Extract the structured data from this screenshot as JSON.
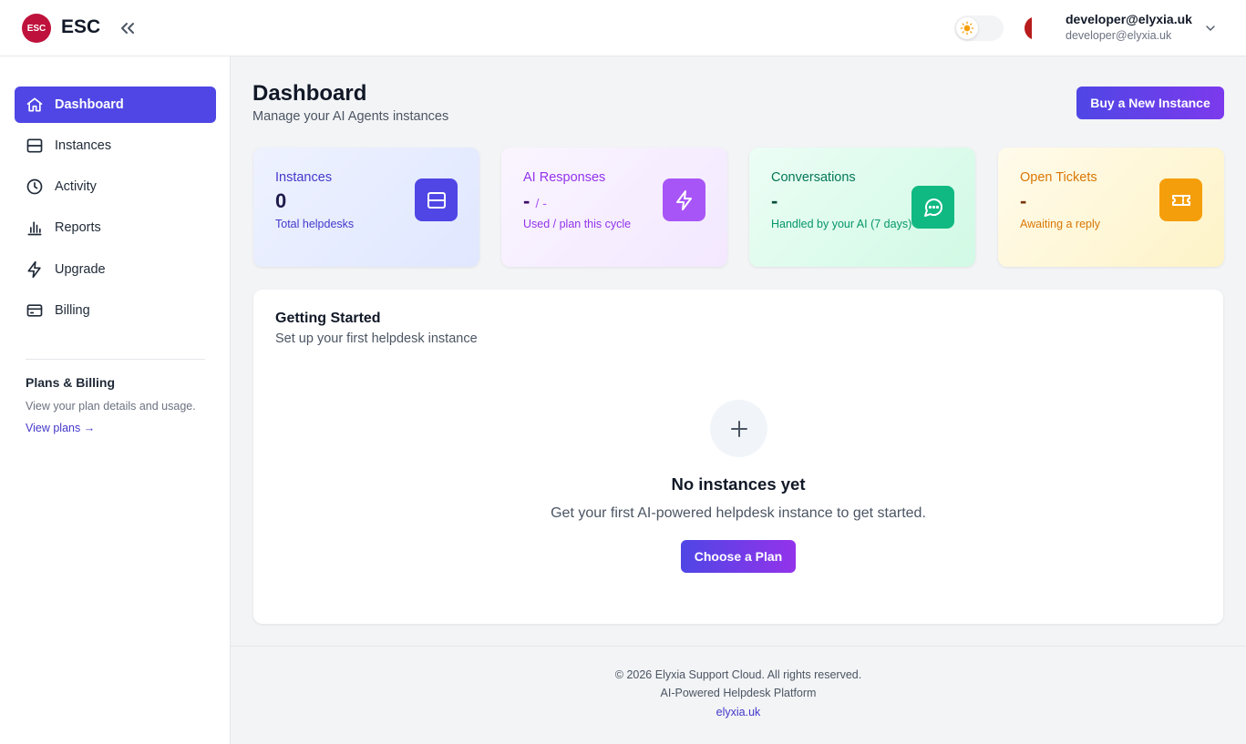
{
  "header": {
    "logo_text": "ESC",
    "brand": "ESC",
    "user_name": "developer@elyxia.uk",
    "user_email": "developer@elyxia.uk",
    "icons": {
      "collapse": "double-chevron-left-icon",
      "theme": "sun-icon",
      "menu": "chevron-down-icon"
    }
  },
  "sidebar": {
    "items": [
      {
        "label": "Dashboard",
        "icon": "home-icon",
        "active": true
      },
      {
        "label": "Instances",
        "icon": "server-icon",
        "active": false
      },
      {
        "label": "Activity",
        "icon": "clock-icon",
        "active": false
      },
      {
        "label": "Reports",
        "icon": "bar-chart-icon",
        "active": false
      },
      {
        "label": "Upgrade",
        "icon": "lightning-icon",
        "active": false
      },
      {
        "label": "Billing",
        "icon": "credit-card-icon",
        "active": false
      }
    ],
    "plans": {
      "title": "Plans & Billing",
      "description": "View your plan details and usage.",
      "link": "View plans →"
    }
  },
  "main": {
    "title": "Dashboard",
    "subtitle": "Manage your AI Agents instances",
    "buy_button": "Buy a New Instance",
    "stats": [
      {
        "label": "Instances",
        "value": "0",
        "sub": "",
        "desc": "Total helpdesks",
        "icon": "server-icon",
        "color": "#4f46e5"
      },
      {
        "label": "AI Responses",
        "value": "-",
        "sub": "/ -",
        "desc": "Used / plan this cycle",
        "icon": "lightning-icon",
        "color": "#a855f7"
      },
      {
        "label": "Conversations",
        "value": "-",
        "sub": "",
        "desc": "Handled by your AI (7 days)",
        "icon": "chat-bubble-icon",
        "color": "#10b981"
      },
      {
        "label": "Open Tickets",
        "value": "-",
        "sub": "",
        "desc": "Awaiting a reply",
        "icon": "ticket-icon",
        "color": "#f59e0b"
      }
    ],
    "getting_started": {
      "title": "Getting Started",
      "subtitle": "Set up your first helpdesk instance",
      "empty_title": "No instances yet",
      "empty_desc": "Get your first AI-powered helpdesk instance to get started.",
      "button": "Choose a Plan",
      "icon": "plus-icon"
    }
  },
  "footer": {
    "copyright": "© 2026 Elyxia Support Cloud. All rights reserved.",
    "tagline": "AI-Powered Helpdesk Platform",
    "link": "elyxia.uk"
  },
  "colors": {
    "accent": "#4f46e5",
    "brand_red": "#be123c"
  }
}
